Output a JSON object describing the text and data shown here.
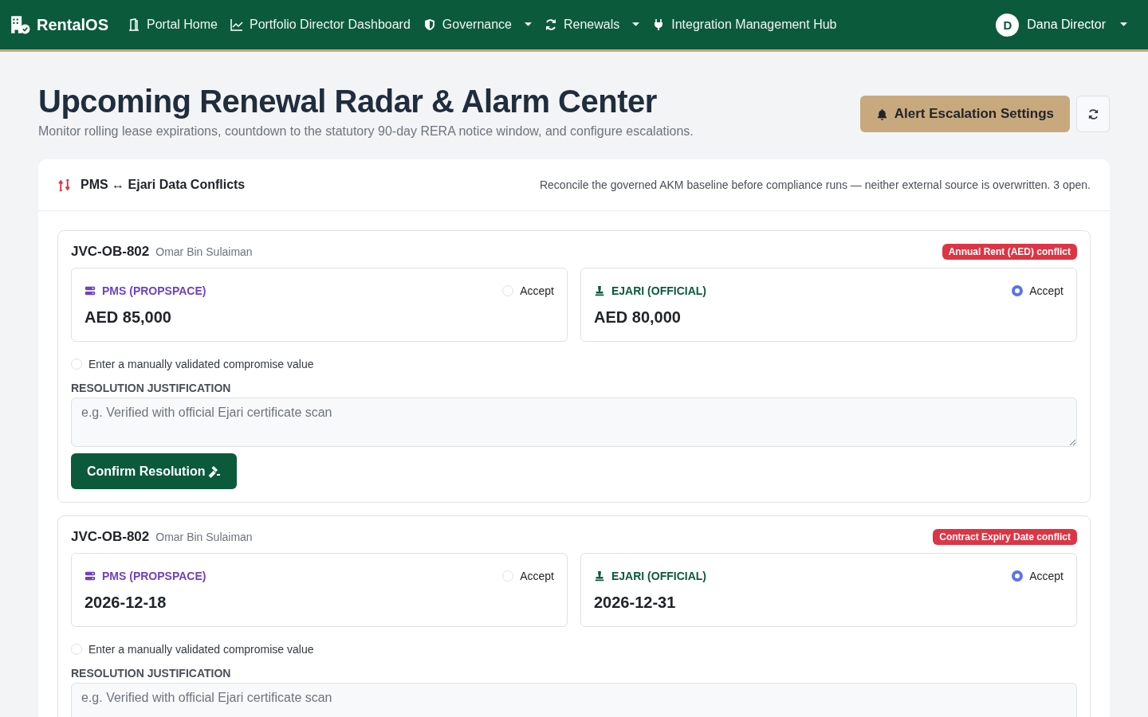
{
  "nav": {
    "brand": "RentalOS",
    "items": [
      {
        "label": "Portal Home",
        "kind": "door",
        "dropdown": false
      },
      {
        "label": "Portfolio Director Dashboard",
        "kind": "chart",
        "dropdown": false
      },
      {
        "label": "Governance",
        "kind": "shield",
        "dropdown": true
      },
      {
        "label": "Renewals",
        "kind": "sync",
        "dropdown": true
      },
      {
        "label": "Integration Management Hub",
        "kind": "plug",
        "dropdown": false
      }
    ],
    "user": {
      "initial": "D",
      "name": "Dana Director"
    }
  },
  "header": {
    "title": "Upcoming Renewal Radar & Alarm Center",
    "subtitle": "Monitor rolling lease expirations, countdown to the statutory 90-day RERA notice window, and configure escalations.",
    "alert_button": "Alert Escalation Settings"
  },
  "panel": {
    "title": "PMS ↔ Ejari Data Conflicts",
    "note": "Reconcile the governed AKM baseline before compliance runs — neither external source is overwritten. 3 open.",
    "conflicts": [
      {
        "ref": "JVC-OB-802",
        "tenant": "Omar Bin Sulaiman",
        "badge": "Annual Rent (AED) conflict",
        "sources": [
          {
            "kind": "pms",
            "label": "PMS (PROPSPACE)",
            "value": "AED 85,000",
            "accept": "Accept",
            "selected": false
          },
          {
            "kind": "ejari",
            "label": "EJARI (OFFICIAL)",
            "value": "AED 80,000",
            "accept": "Accept",
            "selected": true
          }
        ],
        "compromise": {
          "label": "Enter a manually validated compromise value",
          "selected": false
        },
        "justification_label": "RESOLUTION JUSTIFICATION",
        "placeholder": "e.g. Verified with official Ejari certificate scan",
        "confirm": "Confirm Resolution"
      },
      {
        "ref": "JVC-OB-802",
        "tenant": "Omar Bin Sulaiman",
        "badge": "Contract Expiry Date conflict",
        "sources": [
          {
            "kind": "pms",
            "label": "PMS (PROPSPACE)",
            "value": "2026-12-18",
            "accept": "Accept",
            "selected": false
          },
          {
            "kind": "ejari",
            "label": "EJARI (OFFICIAL)",
            "value": "2026-12-31",
            "accept": "Accept",
            "selected": true
          }
        ],
        "compromise": {
          "label": "Enter a manually validated compromise value",
          "selected": false
        },
        "justification_label": "RESOLUTION JUSTIFICATION",
        "placeholder": "e.g. Verified with official Ejari certificate scan"
      }
    ]
  }
}
